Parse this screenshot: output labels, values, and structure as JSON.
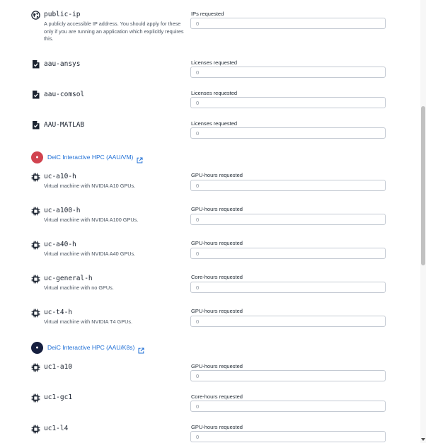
{
  "resources": [
    {
      "icon": "globe-icon",
      "name": "public-ip",
      "description": "A publicly accessible IP address. You should apply for these only if you are running an application which explicitly requires this.",
      "field_label": "IPs requested",
      "placeholder": "0"
    },
    {
      "icon": "license-file-icon",
      "name": "aau-ansys",
      "description": "",
      "field_label": "Licenses requested",
      "placeholder": "0"
    },
    {
      "icon": "license-file-icon",
      "name": "aau-comsol",
      "description": "",
      "field_label": "Licenses requested",
      "placeholder": "0"
    },
    {
      "icon": "license-file-icon",
      "name": "AAU-MATLAB",
      "description": "",
      "field_label": "Licenses requested",
      "placeholder": "0"
    }
  ],
  "providers": [
    {
      "name": "DeiC Interactive HPC (AAU/VM)",
      "logo_color": "#d1434f",
      "external_link_icon": "external-link-icon",
      "products": [
        {
          "icon": "cpu-chip-icon",
          "name": "uc-a10-h",
          "description": "Virtual machine with NVIDIA A10 GPUs.",
          "field_label": "GPU-hours requested",
          "placeholder": "0"
        },
        {
          "icon": "cpu-chip-icon",
          "name": "uc-a100-h",
          "description": "Virtual machine with NVIDIA A100 GPUs.",
          "field_label": "GPU-hours requested",
          "placeholder": "0"
        },
        {
          "icon": "cpu-chip-icon",
          "name": "uc-a40-h",
          "description": "Virtual machine with NVIDIA A40 GPUs.",
          "field_label": "GPU-hours requested",
          "placeholder": "0"
        },
        {
          "icon": "cpu-chip-icon",
          "name": "uc-general-h",
          "description": "Virtual machine with no GPUs.",
          "field_label": "Core-hours requested",
          "placeholder": "0"
        },
        {
          "icon": "cpu-chip-icon",
          "name": "uc-t4-h",
          "description": "Virtual machine with NVIDIA T4 GPUs.",
          "field_label": "GPU-hours requested",
          "placeholder": "0"
        }
      ]
    },
    {
      "name": "DeiC Interactive HPC (AAU/K8s)",
      "logo_color": "#161f3f",
      "external_link_icon": "external-link-icon",
      "products": [
        {
          "icon": "cpu-chip-icon",
          "name": "uc1-a10",
          "description": "",
          "field_label": "GPU-hours requested",
          "placeholder": "0"
        },
        {
          "icon": "cpu-chip-icon",
          "name": "uc1-gc1",
          "description": "",
          "field_label": "Core-hours requested",
          "placeholder": "0"
        },
        {
          "icon": "cpu-chip-icon",
          "name": "uc1-l4",
          "description": "",
          "field_label": "GPU-hours requested",
          "placeholder": "0"
        }
      ]
    }
  ]
}
